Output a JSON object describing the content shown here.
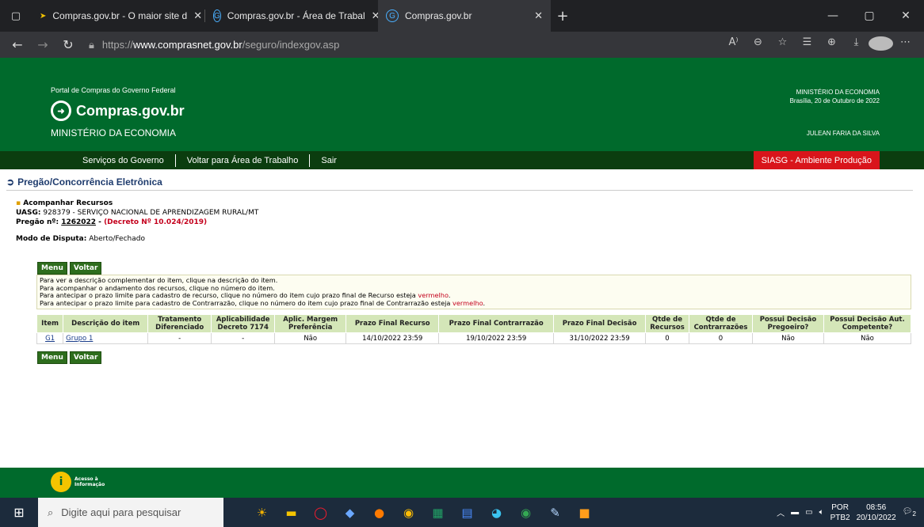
{
  "browser": {
    "tabs": [
      {
        "title": "Compras.gov.br - O maior site d",
        "active": false
      },
      {
        "title": "Compras.gov.br - Área de Trabal",
        "active": false
      },
      {
        "title": "Compras.gov.br",
        "active": true
      }
    ],
    "url_prefix": "https://",
    "url_host": "www.comprasnet.gov.br",
    "url_path": "/seguro/indexgov.asp"
  },
  "header": {
    "portal": "Portal de Compras do Governo Federal",
    "logo": "Compras.gov.br",
    "ministry": "MINISTÉRIO DA ECONOMIA",
    "right_ministry": "MINISTÉRIO DA ECONOMIA",
    "date_line": "Brasília, 20 de Outubro de 2022",
    "user": "JULEAN FARIA DA SILVA"
  },
  "menu": {
    "items": [
      "Serviços do Governo",
      "Voltar para Área de Trabalho",
      "Sair"
    ],
    "env": "SIASG - Ambiente Produção"
  },
  "page": {
    "title": "Pregão/Concorrência Eletrônica",
    "section": "Acompanhar Recursos",
    "uasg_label": "UASG:",
    "uasg_value": "928379 - SERVIÇO NACIONAL DE APRENDIZAGEM RURAL/MT",
    "pregao_label": "Pregão nº:",
    "pregao_number": "1262022",
    "pregao_sep": " - ",
    "decreto": "(Decreto Nº 10.024/2019)",
    "modo_label": "Modo de Disputa:",
    "modo_value": "Aberto/Fechado",
    "btn_menu": "Menu",
    "btn_voltar": "Voltar"
  },
  "notes": {
    "n1": "Para ver a descrição complementar do item, clique na descrição do item.",
    "n2": "Para acompanhar o andamento dos recursos, clique no número do item.",
    "n3": "Para antecipar o prazo limite para cadastro de recurso, clique no número do item cujo prazo final de Recurso esteja ",
    "n4": "Para antecipar o prazo limite para cadastro de Contrarrazão, clique no número do item cujo prazo final de Contrarrazão esteja ",
    "red_word": "vermelho",
    "dot": "."
  },
  "table": {
    "headers": [
      "Item",
      "Descrição do item",
      "Tratamento Diferenciado",
      "Aplicabilidade Decreto 7174",
      "Aplic. Margem Preferência",
      "Prazo Final Recurso",
      "Prazo Final Contrarrazão",
      "Prazo Final Decisão",
      "Qtde de Recursos",
      "Qtde de Contrarrazões",
      "Possui Decisão Pregoeiro?",
      "Possui Decisão Aut. Competente?"
    ],
    "row": [
      "G1",
      "Grupo 1",
      "-",
      "-",
      "Não",
      "14/10/2022 23:59",
      "19/10/2022 23:59",
      "31/10/2022 23:59",
      "0",
      "0",
      "Não",
      "Não"
    ]
  },
  "footer": {
    "acc1": "Acesso à",
    "acc2": "Informação"
  },
  "taskbar": {
    "search": "Digite aqui para pesquisar",
    "lang1": "POR",
    "lang2": "PTB2",
    "time": "08:56",
    "date": "20/10/2022",
    "notif_count": "2"
  }
}
